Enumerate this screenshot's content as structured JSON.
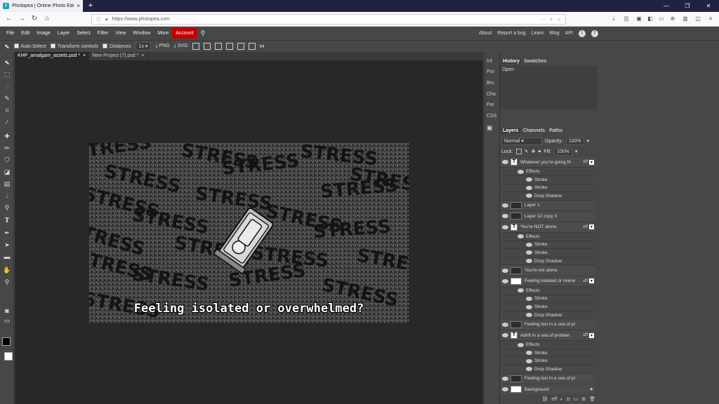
{
  "browser": {
    "tab_title": "Photopea | Online Photo Editor",
    "favicon": "p",
    "new_tab": "+",
    "url": "https://www.photopea.com"
  },
  "menu": {
    "items": [
      "File",
      "Edit",
      "Image",
      "Layer",
      "Select",
      "Filter",
      "View",
      "Window",
      "More",
      "Account"
    ],
    "right_links": [
      "About",
      "Report a bug",
      "Learn",
      "Blog",
      "API"
    ]
  },
  "options": {
    "auto_select": "Auto-Select",
    "transform_controls": "Transform controls",
    "distances": "Distances",
    "zoom": "1x",
    "png": "PNG",
    "svg": "SVG"
  },
  "doc_tabs": [
    {
      "label": "KHP_amalgam_assets.psd *",
      "close": "×"
    },
    {
      "label": "New Project (7).psd *",
      "close": "×"
    }
  ],
  "canvas": {
    "caption": "Feeling isolated or overwhelmed?",
    "background_word": "STRESS"
  },
  "panel_mini": [
    "Inf",
    "Pro",
    "Bru",
    "Cha",
    "Par",
    "CSS"
  ],
  "history_panel": {
    "tabs": [
      "History",
      "Swatches"
    ],
    "item": "Open"
  },
  "layers_panel": {
    "tabs": [
      "Layers",
      "Channels",
      "Paths"
    ],
    "blend_mode": "Normal",
    "opacity_label": "Opacity:",
    "opacity_value": "100%",
    "lock_label": "Lock:",
    "fill_label": "Fill:",
    "fill_value": "100%",
    "layers": [
      {
        "name": "Whatever you're going th",
        "kind": "text",
        "fx": "eff",
        "effects": [
          "Effects",
          "Stroke",
          "Stroke",
          "Drop Shadow"
        ]
      },
      {
        "name": "Layer 1",
        "kind": "dark"
      },
      {
        "name": "Layer 12 copy 3",
        "kind": "dark"
      },
      {
        "name": "You're NOT alone.",
        "kind": "text",
        "fx": "eff",
        "effects": [
          "Effects",
          "Stroke",
          "Stroke",
          "Drop Shadow"
        ]
      },
      {
        "name": "You're not alone.",
        "kind": "dark"
      },
      {
        "name": "Feeling isolated or overw",
        "kind": "white",
        "fx": "eff",
        "effects": [
          "Effects",
          "Stroke",
          "Stroke",
          "Drop Shadow"
        ]
      },
      {
        "name": "Feeling lost in a sea of pr",
        "kind": "dark"
      },
      {
        "name": "Adrift in a sea of problen",
        "kind": "text",
        "fx": "eff",
        "effects": [
          "Effects",
          "Stroke",
          "Stroke",
          "Drop Shadow"
        ]
      },
      {
        "name": "Feeling lost in a sea of pr",
        "kind": "dark"
      },
      {
        "name": "Background",
        "kind": "white"
      }
    ]
  },
  "colors": {
    "account_button": "#c30000",
    "workspace": "#282828",
    "panel": "#474747",
    "browser_tabbar": "#202340"
  }
}
